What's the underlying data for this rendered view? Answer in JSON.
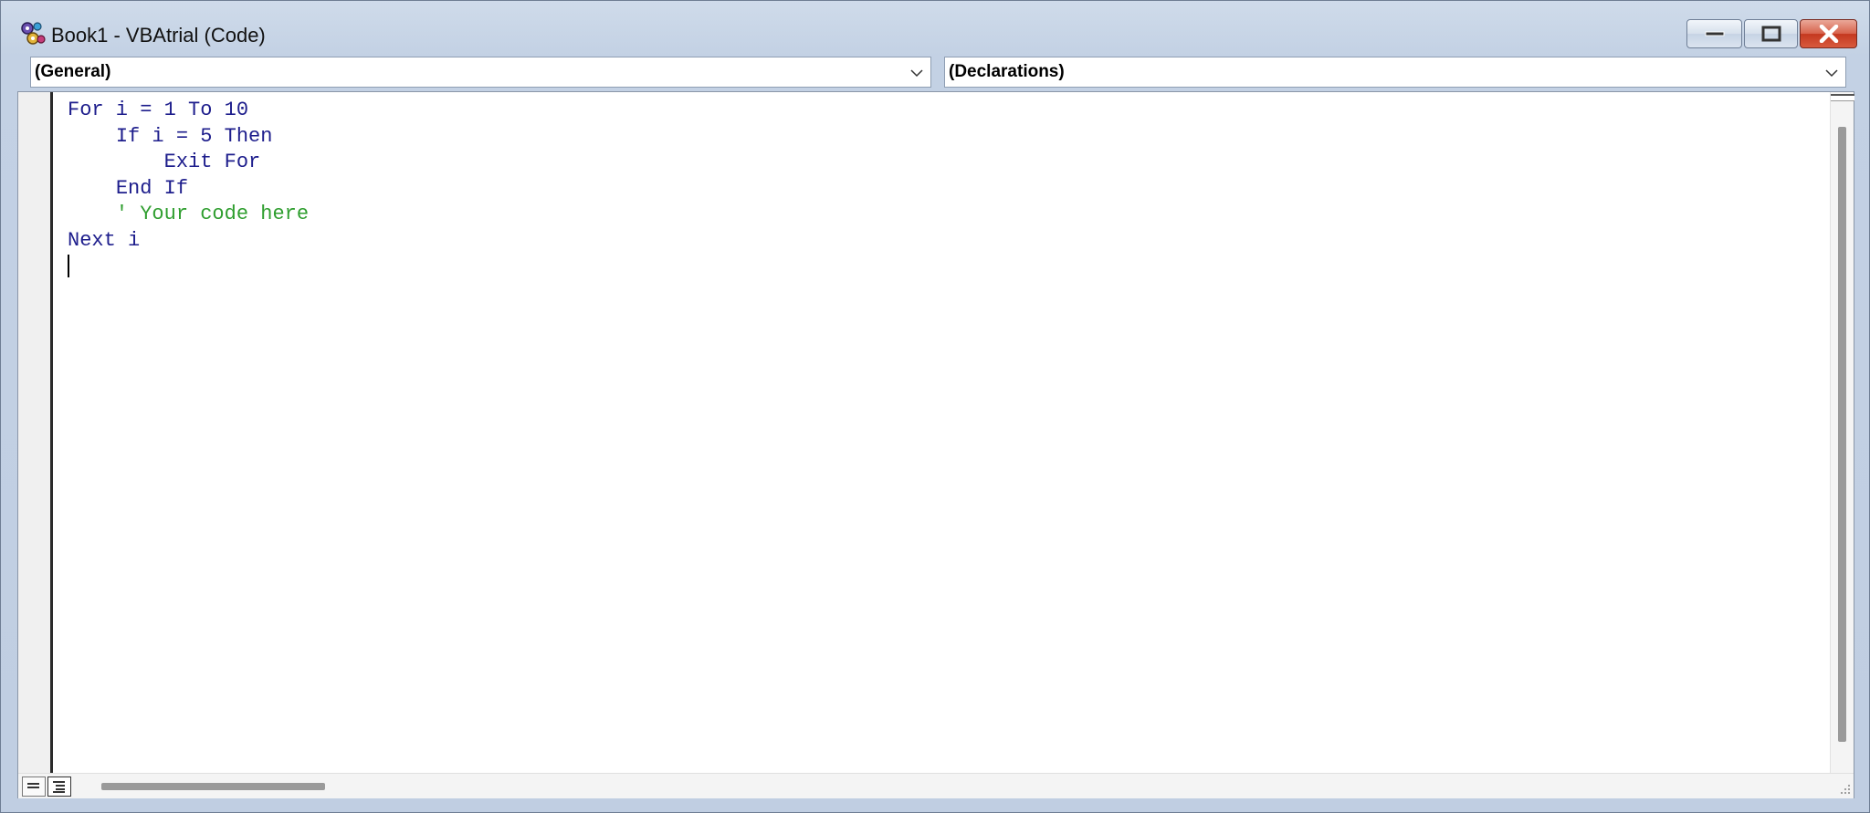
{
  "window": {
    "title": "Book1 - VBAtrial (Code)",
    "icons": {
      "app": "vba-project-icon",
      "minimize": "minimize-icon",
      "maximize": "maximize-icon",
      "close": "close-icon"
    }
  },
  "toolbar": {
    "object_combo": {
      "value": "(General)",
      "icon": "chevron-down-icon"
    },
    "procedure_combo": {
      "value": "(Declarations)",
      "icon": "chevron-down-icon"
    }
  },
  "code": {
    "lines": [
      {
        "indent": "",
        "parts": [
          {
            "t": "For",
            "c": "kw"
          },
          {
            "t": " i = 1 ",
            "c": "tx"
          },
          {
            "t": "To",
            "c": "kw"
          },
          {
            "t": " 10",
            "c": "tx"
          }
        ]
      },
      {
        "indent": "    ",
        "parts": [
          {
            "t": "If",
            "c": "kw"
          },
          {
            "t": " i = 5 ",
            "c": "tx"
          },
          {
            "t": "Then",
            "c": "kw"
          }
        ]
      },
      {
        "indent": "        ",
        "parts": [
          {
            "t": "Exit For",
            "c": "kw"
          }
        ]
      },
      {
        "indent": "    ",
        "parts": [
          {
            "t": "End If",
            "c": "kw"
          }
        ]
      },
      {
        "indent": "    ",
        "parts": [
          {
            "t": "' Your code here",
            "c": "cm"
          }
        ]
      },
      {
        "indent": "",
        "parts": [
          {
            "t": "Next",
            "c": "kw"
          },
          {
            "t": " i",
            "c": "tx"
          }
        ]
      }
    ]
  },
  "colors": {
    "keyword": "#1d1d8c",
    "comment": "#2f9e2f",
    "close_button": "#c4381f",
    "title_bar": "#c3d1e4"
  },
  "view_buttons": {
    "procedure_view": "procedure-view-icon",
    "full_module_view": "full-module-view-icon"
  }
}
